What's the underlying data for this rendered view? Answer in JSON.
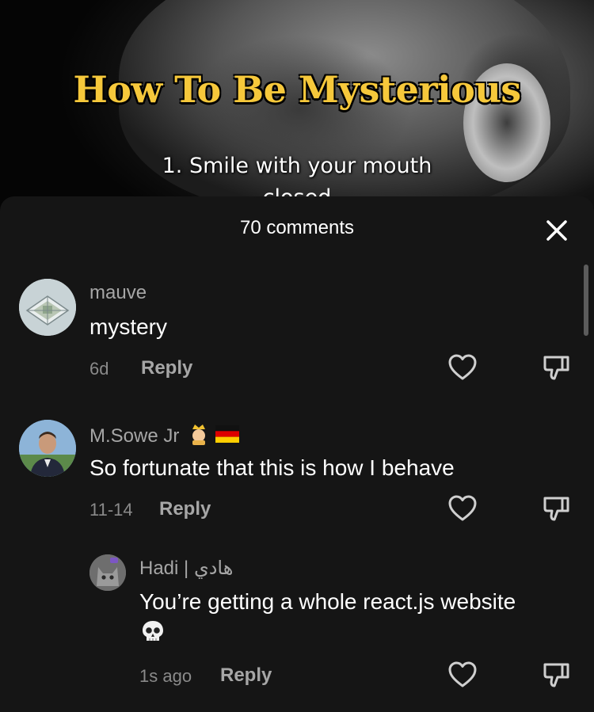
{
  "video": {
    "title": "How To Be Mysterious",
    "caption": "1. Smile with your mouth",
    "caption_cut": "closed"
  },
  "sheet": {
    "comment_count_label": "70 comments"
  },
  "comments": [
    {
      "username": "mauve",
      "text": "mystery",
      "time": "6d",
      "reply_label": "Reply"
    },
    {
      "username": "M.Sowe Jr",
      "username_emojis": [
        "crown-person-emoji",
        "germany-flag-emoji"
      ],
      "text": "So fortunate that this is how I behave",
      "time": "11-14",
      "reply_label": "Reply"
    },
    {
      "username": "Hadi | هادي",
      "text": "You’re getting a whole react.js website",
      "text_emoji": "skull-emoji",
      "time": "1s ago",
      "reply_label": "Reply"
    }
  ],
  "colors": {
    "sheet_bg": "#151515",
    "title_yellow": "#f6c83b",
    "muted_text": "#a6a6a6",
    "time_text": "#8a8a8a"
  }
}
